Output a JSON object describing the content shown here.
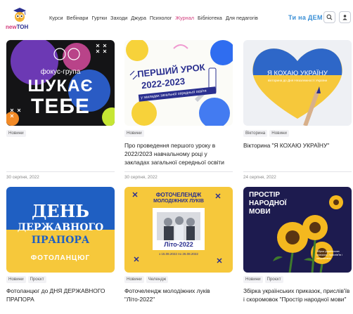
{
  "header": {
    "logo": {
      "prefix": "new",
      "suffix": "ТОН"
    },
    "nav": [
      {
        "label": "Курси",
        "active": false
      },
      {
        "label": "Вебінари",
        "active": false
      },
      {
        "label": "Гуртки",
        "active": false
      },
      {
        "label": "Заходи",
        "active": false
      },
      {
        "label": "Джура",
        "active": false
      },
      {
        "label": "Психолог",
        "active": false
      },
      {
        "label": "Журнал",
        "active": true
      },
      {
        "label": "Бібліотека",
        "active": false
      },
      {
        "label": "Для педагогів",
        "active": false
      }
    ],
    "brand": "Ти на ДЕМ",
    "icons": [
      "search-icon",
      "user-icon"
    ]
  },
  "cards": [
    {
      "id": "focus",
      "thumb": {
        "line1": "фокус-група",
        "line2": "ШУКАЄ",
        "line3": "ТЕБЕ"
      },
      "tags": [
        "Новини"
      ],
      "title": "",
      "date": "30 серпня, 2022"
    },
    {
      "id": "lesson",
      "thumb": {
        "line1": "ПЕРШИЙ УРОК",
        "line2": "2022-2023",
        "line3": "у закладах загальної середньої освіти"
      },
      "tags": [
        "Новини"
      ],
      "title": "Про проведення першого уроку в 2022/2023 навчальному році у закладах загальної середньої освіти",
      "date": "30 серпня, 2022"
    },
    {
      "id": "love",
      "thumb": {
        "line1": "Я КОХАЮ УКРАЇНУ",
        "line2": "вікторина до Дня Незалежності України"
      },
      "tags": [
        "Вікторина",
        "Новини"
      ],
      "title": "Вікторина \"Я КОХАЮ УКРАЇНУ\"",
      "date": "24 серпня, 2022"
    },
    {
      "id": "flag",
      "thumb": {
        "line1": "ДЕНЬ",
        "line2": "ДЕРЖАВНОГО",
        "line3": "ПРАПОРА",
        "line4": "ФОТОЛАНЦЮГ"
      },
      "tags": [
        "Новини",
        "Проєкт"
      ],
      "title": "Фотоланцюг до ДНЯ ДЕРЖАВНОГО ПРАПОРА",
      "date": ""
    },
    {
      "id": "summer",
      "thumb": {
        "line1": "ФОТОЧЕЛЕНДЖ",
        "line2": "МОЛОДІЖНИХ ЛУКІВ",
        "line3": "Літо-2022",
        "line4": "з 15.08.2022 по 26.08.2022"
      },
      "tags": [
        "Новини",
        "Челендж"
      ],
      "title": "Фоточелендж молодіжних луків \"Літо-2022\"",
      "date": ""
    },
    {
      "id": "folk",
      "thumb": {
        "line1": "ПРОСТІР",
        "line2": "НАРОДНОЇ",
        "line3": "МОВИ",
        "line4": "Збірка українських приказок, прислів'їв і скоромовок"
      },
      "tags": [
        "Новини",
        "Проєкт"
      ],
      "title": "Збірка українських приказок, прислів'їв і скоромовок \"Простір народної мови\"",
      "date": ""
    }
  ],
  "colors": {
    "accent": "#d23b7c",
    "brand_blue": "#3a8fd6",
    "tag_bg": "#f2f2f5",
    "flag_blue": "#1f5fc2",
    "flag_yellow": "#f6c83b"
  }
}
